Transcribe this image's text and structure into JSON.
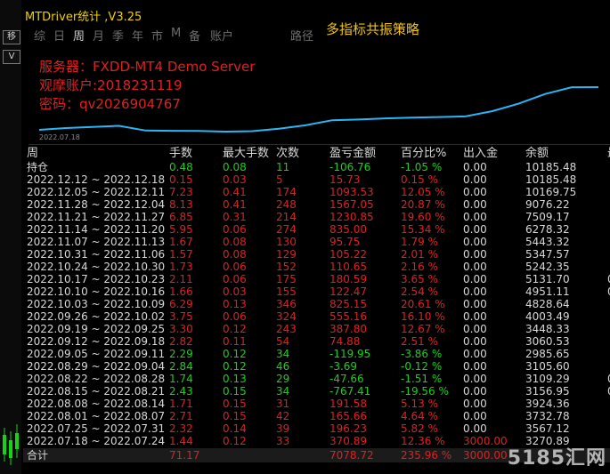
{
  "app": {
    "title": "MTDriver统计 ,V3.25"
  },
  "toolbar": {
    "items": [
      "综",
      "日",
      "周",
      "月",
      "季",
      "年",
      "市",
      "M",
      "备",
      "账户",
      "路径"
    ],
    "strategy_label": "多指标共振策略"
  },
  "account": {
    "server": "服务器：FXDD-MT4 Demo Server",
    "viewer": "观摩账户:2018231119",
    "password": "密码：qv2026904767"
  },
  "chart": {
    "date_label": "2022.07.18",
    "line_color": "#29b6f6"
  },
  "chart_data": {
    "type": "line",
    "x": [
      "2022.07.18",
      "2022.07.25",
      "2022.08.01",
      "2022.08.08",
      "2022.08.15",
      "2022.08.22",
      "2022.08.29",
      "2022.09.05",
      "2022.09.12",
      "2022.09.19",
      "2022.09.26",
      "2022.10.03",
      "2022.10.10",
      "2022.10.17",
      "2022.10.24",
      "2022.10.31",
      "2022.11.07",
      "2022.11.14",
      "2022.11.21",
      "2022.11.28",
      "2022.12.05",
      "2022.12.12"
    ],
    "y": [
      3270.89,
      3567.12,
      3732.78,
      3924.36,
      3156.95,
      3109.29,
      3105.6,
      2985.65,
      3060.53,
      3448.33,
      4003.49,
      4828.64,
      4951.11,
      5131.7,
      5242.35,
      5347.57,
      5443.32,
      6278.32,
      7509.17,
      9076.22,
      10169.75,
      10185.48
    ]
  },
  "table": {
    "headers": [
      "周",
      "手数",
      "最大手数",
      "次数",
      "盈亏金额",
      "百分比%",
      "出入金",
      "余额",
      "最"
    ],
    "position_row": {
      "label": "持仓",
      "lots": "0.48",
      "max_lots": "0.08",
      "count": "11",
      "pnl": "-106.76",
      "pct": "-1.05 %",
      "inout": "0.00",
      "balance": "10185.48"
    },
    "rows": [
      {
        "week": "2022.12.12 ~ 2022.12.18",
        "lots": "0.15",
        "max": "0.03",
        "count": "5",
        "pnl": "15.73",
        "pct": "0.15 %",
        "inout": "0.00",
        "balance": "10185.48",
        "extra": ""
      },
      {
        "week": "2022.12.05 ~ 2022.12.11",
        "lots": "7.23",
        "max": "0.41",
        "count": "174",
        "pnl": "1093.53",
        "pct": "12.05 %",
        "inout": "0.00",
        "balance": "10169.75",
        "extra": ""
      },
      {
        "week": "2022.11.28 ~ 2022.12.04",
        "lots": "8.13",
        "max": "0.41",
        "count": "248",
        "pnl": "1567.05",
        "pct": "20.87 %",
        "inout": "0.00",
        "balance": "9076.22",
        "extra": ""
      },
      {
        "week": "2022.11.21 ~ 2022.11.27",
        "lots": "6.85",
        "max": "0.31",
        "count": "214",
        "pnl": "1230.85",
        "pct": "19.60 %",
        "inout": "0.00",
        "balance": "7509.17",
        "extra": ""
      },
      {
        "week": "2022.11.14 ~ 2022.11.20",
        "lots": "5.95",
        "max": "0.06",
        "count": "274",
        "pnl": "835.00",
        "pct": "15.34 %",
        "inout": "0.00",
        "balance": "6278.32",
        "extra": ""
      },
      {
        "week": "2022.11.07 ~ 2022.11.13",
        "lots": "1.67",
        "max": "0.08",
        "count": "130",
        "pnl": "95.75",
        "pct": "1.79 %",
        "inout": "0.00",
        "balance": "5443.32",
        "extra": ""
      },
      {
        "week": "2022.10.31 ~ 2022.11.06",
        "lots": "1.57",
        "max": "0.08",
        "count": "129",
        "pnl": "105.22",
        "pct": "2.01 %",
        "inout": "0.00",
        "balance": "5347.57",
        "extra": ""
      },
      {
        "week": "2022.10.24 ~ 2022.10.30",
        "lots": "1.73",
        "max": "0.06",
        "count": "152",
        "pnl": "110.65",
        "pct": "2.16 %",
        "inout": "0.00",
        "balance": "5242.35",
        "extra": ""
      },
      {
        "week": "2022.10.17 ~ 2022.10.23",
        "lots": "2.11",
        "max": "0.06",
        "count": "175",
        "pnl": "180.59",
        "pct": "3.65 %",
        "inout": "0.00",
        "balance": "5131.70",
        "extra": "0"
      },
      {
        "week": "2022.10.10 ~ 2022.10.16",
        "lots": "1.66",
        "max": "0.03",
        "count": "155",
        "pnl": "122.47",
        "pct": "2.54 %",
        "inout": "0.00",
        "balance": "4951.11",
        "extra": "0"
      },
      {
        "week": "2022.10.03 ~ 2022.10.09",
        "lots": "6.29",
        "max": "0.13",
        "count": "346",
        "pnl": "825.15",
        "pct": "20.61 %",
        "inout": "0.00",
        "balance": "4828.64",
        "extra": ""
      },
      {
        "week": "2022.09.26 ~ 2022.10.02",
        "lots": "3.75",
        "max": "0.06",
        "count": "324",
        "pnl": "555.16",
        "pct": "16.10 %",
        "inout": "0.00",
        "balance": "4003.49",
        "extra": ""
      },
      {
        "week": "2022.09.19 ~ 2022.09.25",
        "lots": "3.30",
        "max": "0.12",
        "count": "243",
        "pnl": "387.80",
        "pct": "12.67 %",
        "inout": "0.00",
        "balance": "3448.33",
        "extra": ""
      },
      {
        "week": "2022.09.12 ~ 2022.09.18",
        "lots": "2.82",
        "max": "0.11",
        "count": "54",
        "pnl": "74.88",
        "pct": "2.51 %",
        "inout": "0.00",
        "balance": "3060.53",
        "extra": ""
      },
      {
        "week": "2022.09.05 ~ 2022.09.11",
        "lots": "2.29",
        "max": "0.12",
        "count": "34",
        "pnl": "-119.95",
        "pct": "-3.86 %",
        "inout": "0.00",
        "balance": "2985.65",
        "extra": ""
      },
      {
        "week": "2022.08.29 ~ 2022.09.04",
        "lots": "2.84",
        "max": "0.12",
        "count": "46",
        "pnl": "-3.69",
        "pct": "-0.12 %",
        "inout": "0.00",
        "balance": "3105.60",
        "extra": ""
      },
      {
        "week": "2022.08.22 ~ 2022.08.28",
        "lots": "1.74",
        "max": "0.13",
        "count": "29",
        "pnl": "-47.66",
        "pct": "-1.51 %",
        "inout": "0.00",
        "balance": "3109.29",
        "extra": "0"
      },
      {
        "week": "2022.08.15 ~ 2022.08.21",
        "lots": "2.43",
        "max": "0.15",
        "count": "34",
        "pnl": "-767.41",
        "pct": "-19.56 %",
        "inout": "0.00",
        "balance": "3156.95",
        "extra": "0"
      },
      {
        "week": "2022.08.08 ~ 2022.08.14",
        "lots": "1.71",
        "max": "0.15",
        "count": "31",
        "pnl": "191.58",
        "pct": "5.13 %",
        "inout": "0.00",
        "balance": "3924.36",
        "extra": ""
      },
      {
        "week": "2022.08.01 ~ 2022.08.07",
        "lots": "2.71",
        "max": "0.15",
        "count": "42",
        "pnl": "165.66",
        "pct": "4.64 %",
        "inout": "0.00",
        "balance": "3732.78",
        "extra": ""
      },
      {
        "week": "2022.07.25 ~ 2022.07.31",
        "lots": "2.32",
        "max": "0.14",
        "count": "39",
        "pnl": "196.23",
        "pct": "5.82 %",
        "inout": "0.00",
        "balance": "3567.12",
        "extra": ""
      },
      {
        "week": "2022.07.18 ~ 2022.07.24",
        "lots": "1.44",
        "max": "0.12",
        "count": "33",
        "pnl": "370.89",
        "pct": "12.36 %",
        "inout": "3000.00",
        "balance": "3270.89",
        "extra": ""
      }
    ],
    "total_row": {
      "label": "合计",
      "lots": "71.17",
      "pnl": "7078.72",
      "pct": "235.96 %",
      "inout": "3000.00"
    }
  },
  "left_strip": {
    "buttons": [
      "移",
      "V"
    ]
  },
  "watermark": "5185汇网"
}
